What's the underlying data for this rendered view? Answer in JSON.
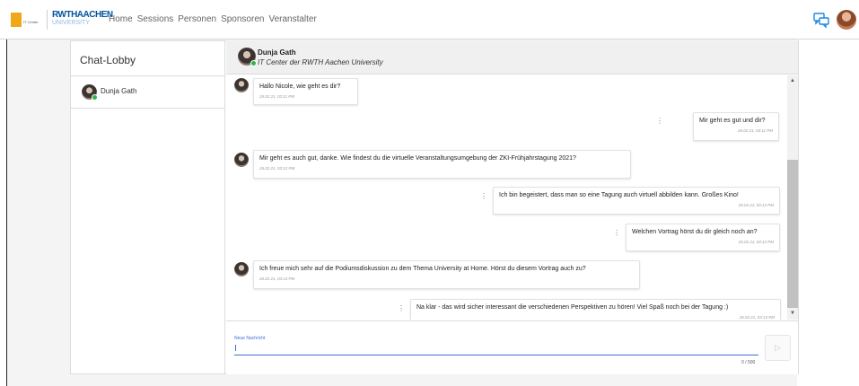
{
  "header": {
    "logo_it_small": "IT Center",
    "logo_rwth_main": "RWTHAACHEN",
    "logo_rwth_sub": "UNIVERSITY",
    "nav": [
      "Home",
      "Sessions",
      "Personen",
      "Sponsoren",
      "Veranstalter"
    ]
  },
  "sidebar": {
    "title": "Chat-Lobby",
    "items": [
      {
        "label": "Dunja Gath",
        "status": "online"
      }
    ]
  },
  "chat": {
    "partner_name": "Dunja Gath",
    "partner_org": "IT Center der RWTH Aachen University",
    "messages": [
      {
        "side": "left",
        "text": "Hallo Nicole, wie geht es dir?",
        "time": "26.02.21, 03:11 PM"
      },
      {
        "side": "right",
        "text": "Mir geht es gut und dir?",
        "time": "26.02.21, 03:11 PM"
      },
      {
        "side": "left",
        "text": "Mir geht es auch gut, danke. Wie findest du die virtuelle Veranstaltungsumgebung der ZKI-Frühjahrstagung 2021?",
        "time": "26.02.21, 03:12 PM"
      },
      {
        "side": "right",
        "text": "Ich bin begeistert, dass man so eine Tagung auch virtuell abbilden kann. Großes Kino!",
        "time": "26.02.21, 03:13 PM"
      },
      {
        "side": "right",
        "text": "Welchen Vortrag hörst du dir gleich noch an?",
        "time": "26.02.21, 03:13 PM"
      },
      {
        "side": "left",
        "text": "Ich freue mich sehr auf die Podiumsdiskussion zu dem Thema University at Home. Hörst du diesem Vortrag auch zu?",
        "time": "26.02.21, 03:14 PM"
      },
      {
        "side": "right",
        "text": "Na klar - das wird sicher interessant die verschiedenen Perspektiven zu hören! Viel Spaß noch bei der Tagung :)",
        "time": "26.02.21, 03:14 PM"
      }
    ],
    "input": {
      "label": "Neue Nachricht",
      "value": "",
      "counter": "0 / 500"
    },
    "send_icon": "send-icon"
  }
}
